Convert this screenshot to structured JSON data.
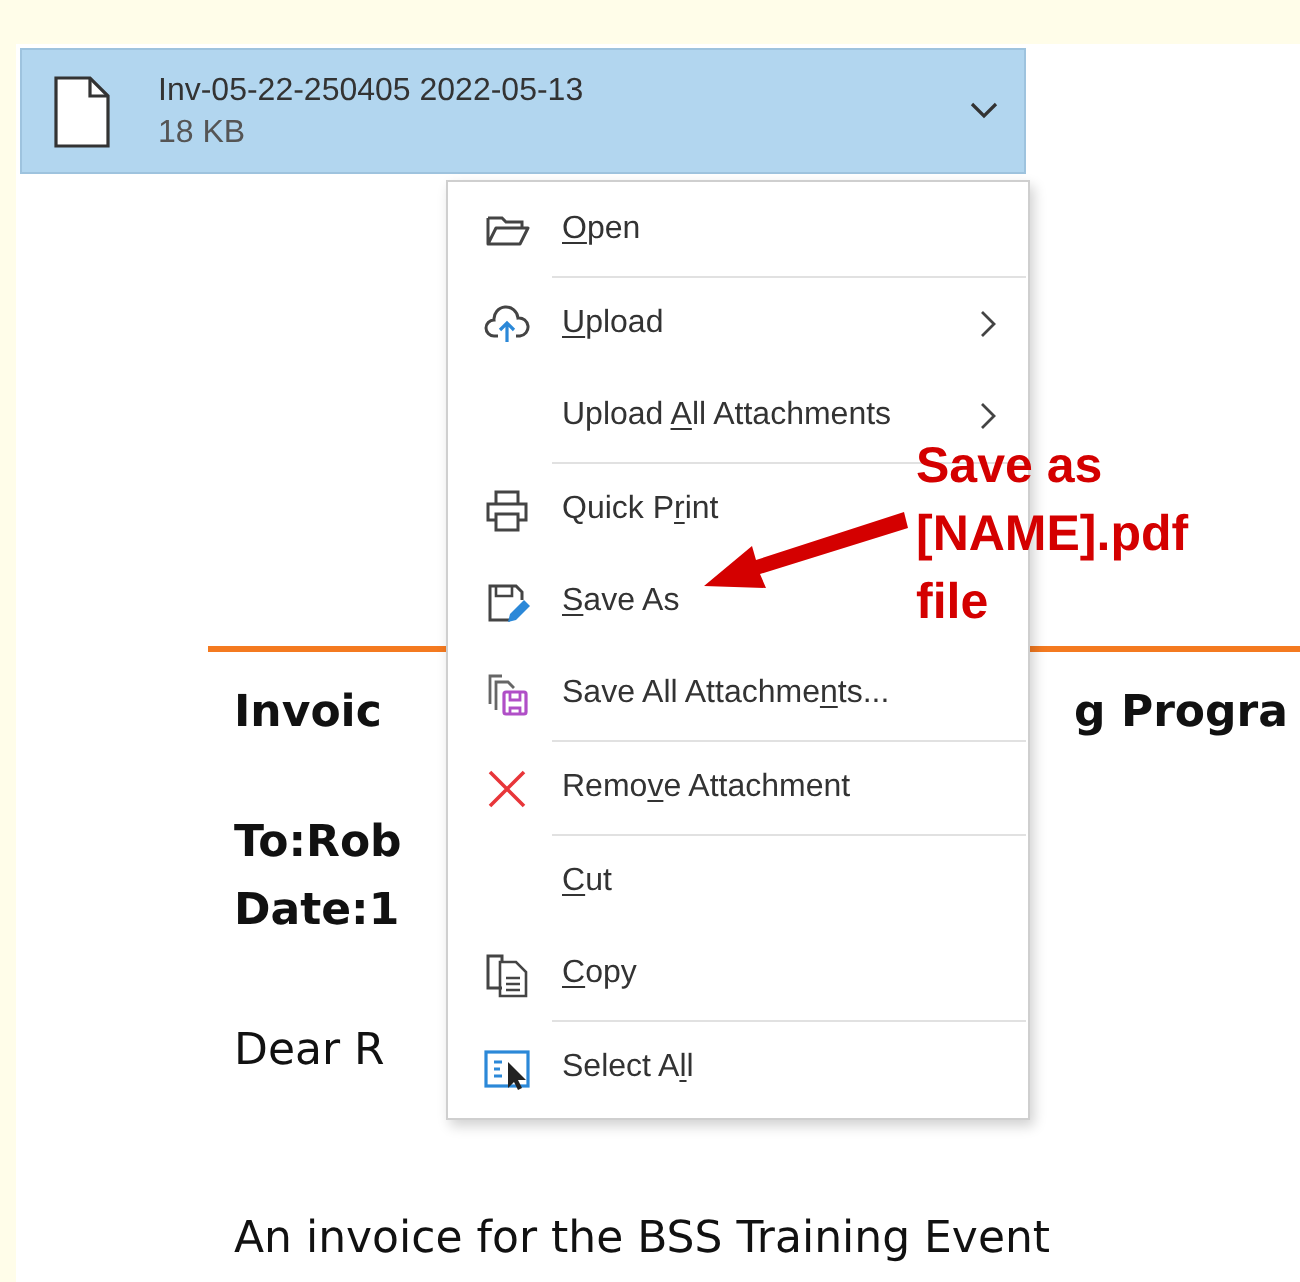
{
  "attachment": {
    "name": "Inv-05-22-250405 2022-05-13",
    "size": "18 KB",
    "selected": true
  },
  "context_menu": [
    {
      "kind": "item",
      "label": {
        "key": "O",
        "after": "pen"
      },
      "submenu": false
    },
    {
      "kind": "separator"
    },
    {
      "kind": "item",
      "label": {
        "key": "U",
        "after": "pload"
      },
      "submenu": true
    },
    {
      "kind": "item",
      "label": {
        "before": "Upload ",
        "key": "A",
        "after": "ll Attachments"
      },
      "submenu": true
    },
    {
      "kind": "separator"
    },
    {
      "kind": "item",
      "label": {
        "before": "Quick P",
        "key": "r",
        "after": "int"
      },
      "submenu": false
    },
    {
      "kind": "item",
      "label": {
        "key": "S",
        "after": "ave As"
      },
      "submenu": false
    },
    {
      "kind": "item",
      "label": {
        "before": "Save All Attachme",
        "key": "n",
        "after": "ts..."
      },
      "submenu": false
    },
    {
      "kind": "separator"
    },
    {
      "kind": "item",
      "label": {
        "before": "Remo",
        "key": "v",
        "after": "e Attachment"
      },
      "submenu": false
    },
    {
      "kind": "separator"
    },
    {
      "kind": "item",
      "label": {
        "key": "C",
        "after": "ut"
      },
      "submenu": false
    },
    {
      "kind": "item",
      "label": {
        "key": "C",
        "after": "opy"
      },
      "submenu": false
    },
    {
      "kind": "separator"
    },
    {
      "kind": "item",
      "label": {
        "before": "Select A",
        "key": "l",
        "after": "l"
      },
      "submenu": false
    }
  ],
  "annotation": {
    "lines": [
      "Save as",
      "[NAME].pdf",
      "file"
    ]
  },
  "document": {
    "heading_left": "Invoic",
    "heading_right": "g Progra",
    "to": "To:Rob",
    "date": "Date:1",
    "greeting": "Dear R",
    "body": "An invoice for the BSS Training Event"
  }
}
